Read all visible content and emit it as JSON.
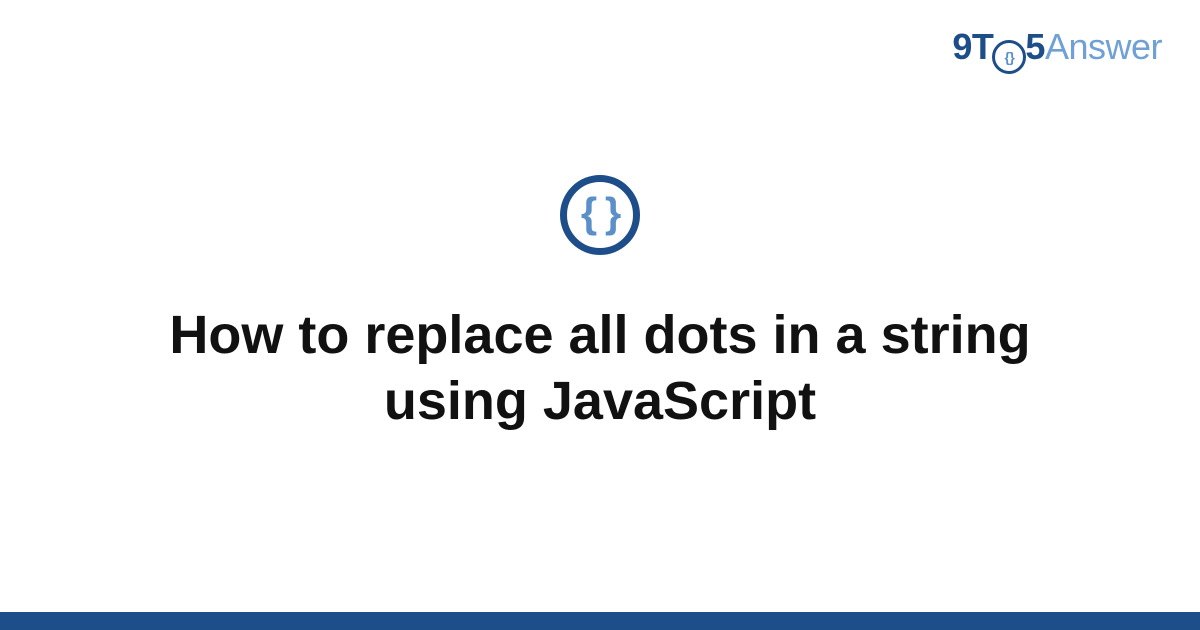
{
  "brand": {
    "prefix": "9T",
    "middle": "5",
    "suffix": "Answer"
  },
  "badge": {
    "glyph": "{ }"
  },
  "title": "How to replace all dots in a string using JavaScript",
  "colors": {
    "primary": "#1d4e89",
    "accent": "#5a8fc7",
    "text": "#111111"
  }
}
